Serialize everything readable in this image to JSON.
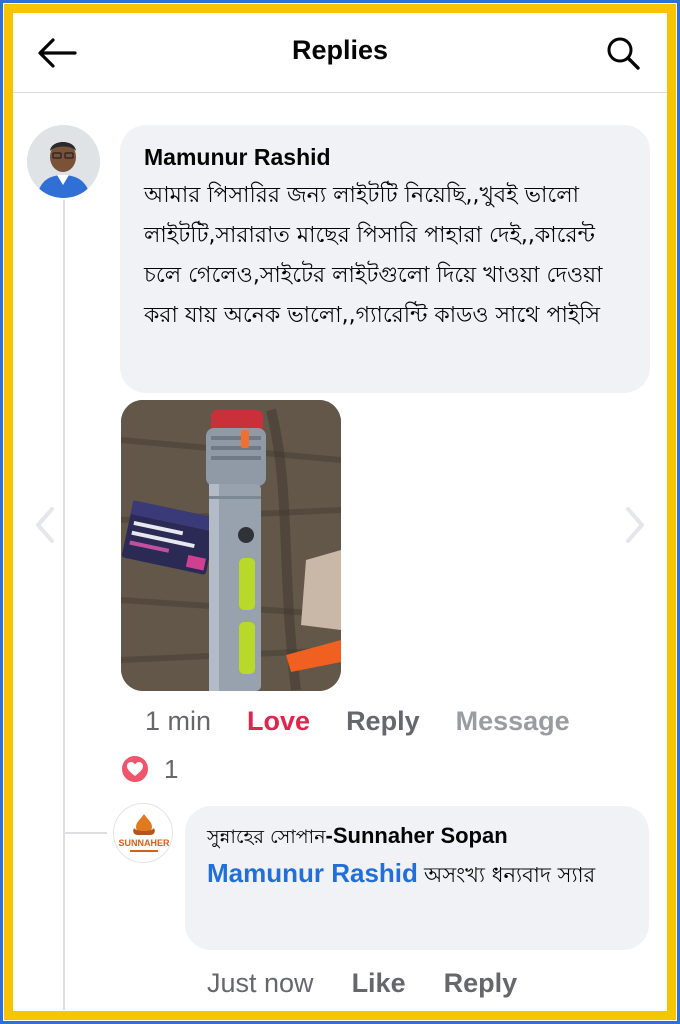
{
  "header": {
    "title": "Replies",
    "back_icon": "arrow-left-icon",
    "search_icon": "search-icon"
  },
  "comment": {
    "author": "Mamunur Rashid",
    "text": "আমার পিসারির জন্য লাইটটি নিয়েছি,,খুবই ভালো লাইটটি,সারারাত মাছের পিসারি পাহারা দেই,,কারেন্ট চলে গেলেও,সাইটের লাইটগুলো দিয়ে খাওয়া দেওয়া করা যায় অনেক ভালো,,গ্যারেন্টি কাডও সাথে পাইসি",
    "photo_label": "flashlight photo",
    "time": "1 min",
    "love_label": "Love",
    "reply_label": "Reply",
    "message_label": "Message",
    "reaction_icon": "heart-icon",
    "reaction_count": "1"
  },
  "reply": {
    "author_bn": "সুন্নাহের সোপান",
    "author_en": "-Sunnaher Sopan",
    "mention": "Mamunur Rashid",
    "text": "অসংখ্য ধন্যবাদ স্যার",
    "avatar_logo_text": "SUNNAHER",
    "time": "Just now",
    "like_label": "Like",
    "reply_label": "Reply"
  },
  "colors": {
    "accent_blue": "#216fdb",
    "love_red": "#e0244b",
    "frame_yellow": "#f6c400",
    "frame_blue": "#2f6fd6",
    "bubble_bg": "#f0f2f5"
  }
}
